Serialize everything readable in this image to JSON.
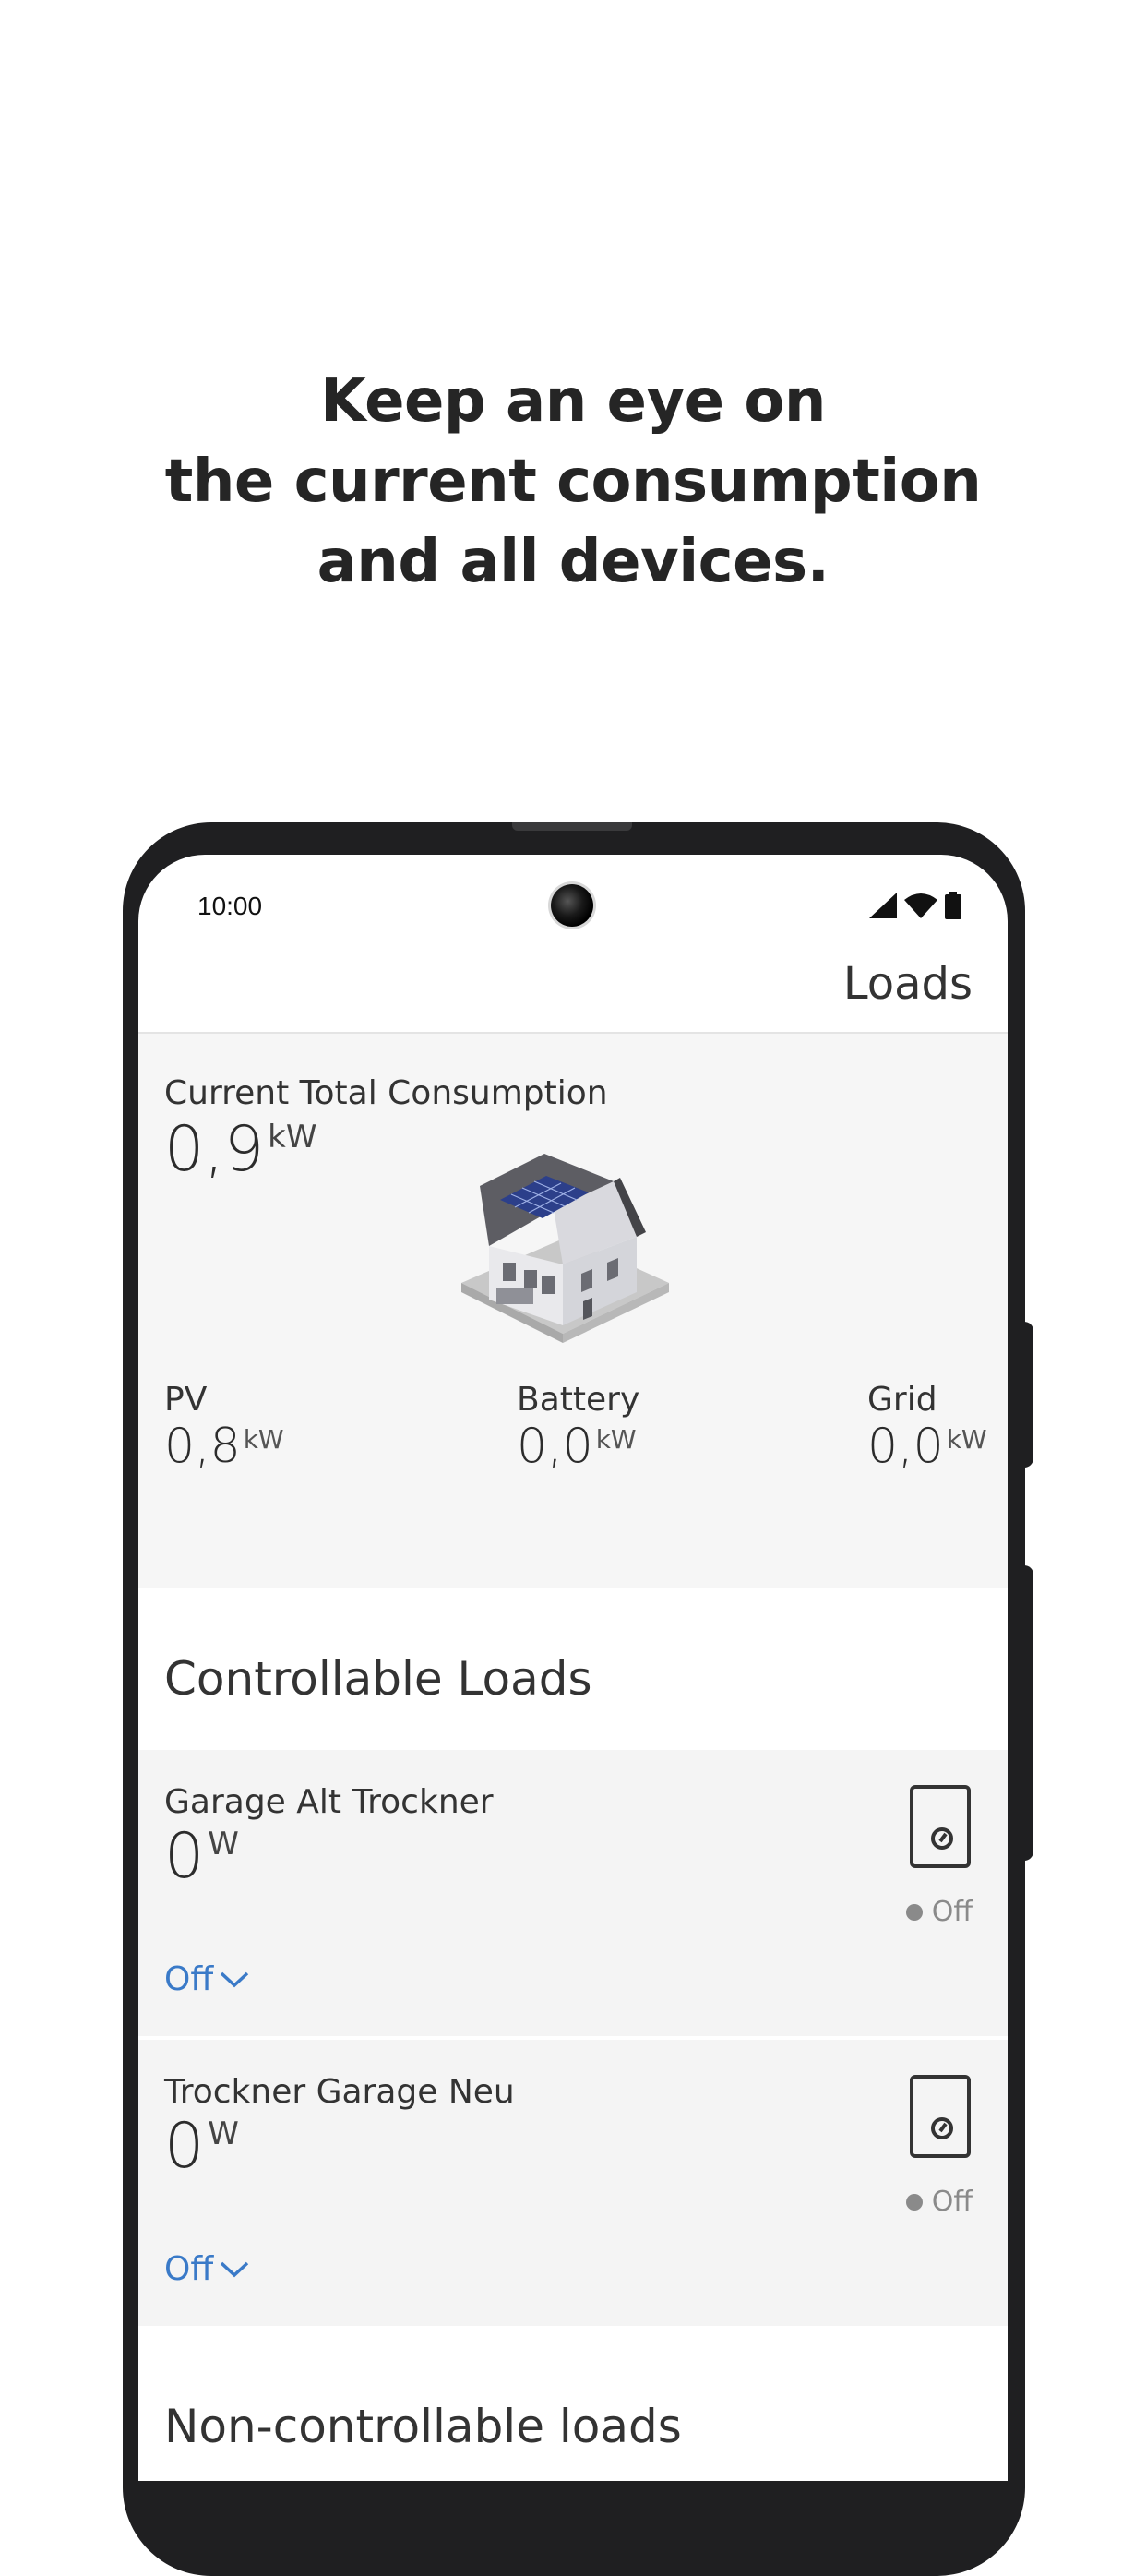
{
  "headline": {
    "line1": "Keep an eye on",
    "line2": "the current consumption",
    "line3": "and all devices."
  },
  "status_bar": {
    "time": "10:00",
    "icons": [
      "signal-icon",
      "wifi-icon",
      "battery-icon"
    ]
  },
  "app_bar": {
    "title": "Loads"
  },
  "consumption": {
    "label": "Current Total Consumption",
    "value": "0,9",
    "unit": "kW",
    "metrics": [
      {
        "label": "PV",
        "value": "0,8",
        "unit": "kW"
      },
      {
        "label": "Battery",
        "value": "0,0",
        "unit": "kW"
      },
      {
        "label": "Grid",
        "value": "0,0",
        "unit": "kW"
      }
    ]
  },
  "controllable": {
    "title": "Controllable Loads",
    "loads": [
      {
        "name": "Garage Alt Trockner",
        "value": "0",
        "unit": "W",
        "status": "Off",
        "mode": "Off"
      },
      {
        "name": "Trockner Garage Neu",
        "value": "0",
        "unit": "W",
        "status": "Off",
        "mode": "Off"
      }
    ]
  },
  "non_controllable": {
    "title": "Non-controllable loads"
  },
  "colors": {
    "accent_blue": "#3a7ac8",
    "panel_bg": "#f6f6f6",
    "frame": "#1f1f21",
    "status_gray": "#8a8a8a"
  }
}
